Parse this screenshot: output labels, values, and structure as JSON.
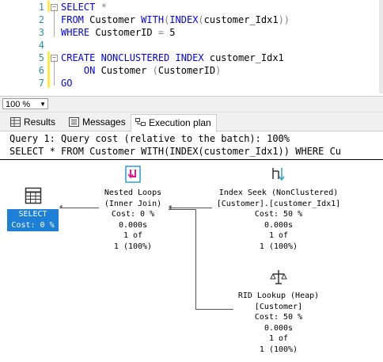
{
  "editor": {
    "lines": [
      {
        "num": "1",
        "parts": [
          {
            "t": "SELECT",
            "c": "kw"
          },
          {
            "t": " *",
            "c": "gray"
          }
        ]
      },
      {
        "num": "2",
        "parts": [
          {
            "t": "FROM",
            "c": "kw"
          },
          {
            "t": " Customer ",
            "c": ""
          },
          {
            "t": "WITH",
            "c": "kw"
          },
          {
            "t": "(",
            "c": "gray"
          },
          {
            "t": "INDEX",
            "c": "kw"
          },
          {
            "t": "(",
            "c": "gray"
          },
          {
            "t": "customer_Idx1",
            "c": ""
          },
          {
            "t": "))",
            "c": "gray"
          }
        ]
      },
      {
        "num": "3",
        "parts": [
          {
            "t": "WHERE",
            "c": "kw"
          },
          {
            "t": " CustomerID ",
            "c": ""
          },
          {
            "t": "=",
            "c": "gray"
          },
          {
            "t": " 5",
            "c": ""
          }
        ]
      },
      {
        "num": "4",
        "parts": []
      },
      {
        "num": "5",
        "parts": [
          {
            "t": "CREATE NONCLUSTERED INDEX",
            "c": "kw"
          },
          {
            "t": " customer_Idx1",
            "c": ""
          }
        ]
      },
      {
        "num": "6",
        "parts": [
          {
            "t": "    ON",
            "c": "kw"
          },
          {
            "t": " Customer ",
            "c": ""
          },
          {
            "t": "(",
            "c": "gray"
          },
          {
            "t": "CustomerID",
            "c": ""
          },
          {
            "t": ")",
            "c": "gray"
          }
        ]
      },
      {
        "num": "7",
        "parts": [
          {
            "t": "GO",
            "c": "kw"
          }
        ]
      }
    ]
  },
  "zoom": {
    "value": "100 %"
  },
  "tabs": [
    {
      "label": "Results",
      "icon": "grid-icon"
    },
    {
      "label": "Messages",
      "icon": "messages-icon"
    },
    {
      "label": "Execution plan",
      "icon": "execution-plan-icon"
    }
  ],
  "plan": {
    "query_header": "Query 1: Query cost (relative to the batch): 100%",
    "query_sql": "SELECT * FROM Customer WITH(INDEX(customer_Idx1)) WHERE Cu",
    "select_node": {
      "label": "SELECT",
      "cost": "Cost: 0 %"
    },
    "nested_loops": {
      "title": "Nested Loops",
      "subtitle": "(Inner Join)",
      "cost": "Cost: 0 %",
      "time": "0.000s",
      "rows": "1 of",
      "pct": "1 (100%)"
    },
    "index_seek": {
      "title": "Index Seek (NonClustered)",
      "subtitle": "[Customer].[customer_Idx1]",
      "cost": "Cost: 50 %",
      "time": "0.000s",
      "rows": "1 of",
      "pct": "1 (100%)"
    },
    "rid_lookup": {
      "title": "RID Lookup (Heap)",
      "subtitle": "[Customer]",
      "cost": "Cost: 50 %",
      "time": "0.000s",
      "rows": "1 of",
      "pct": "1 (100%)"
    }
  }
}
